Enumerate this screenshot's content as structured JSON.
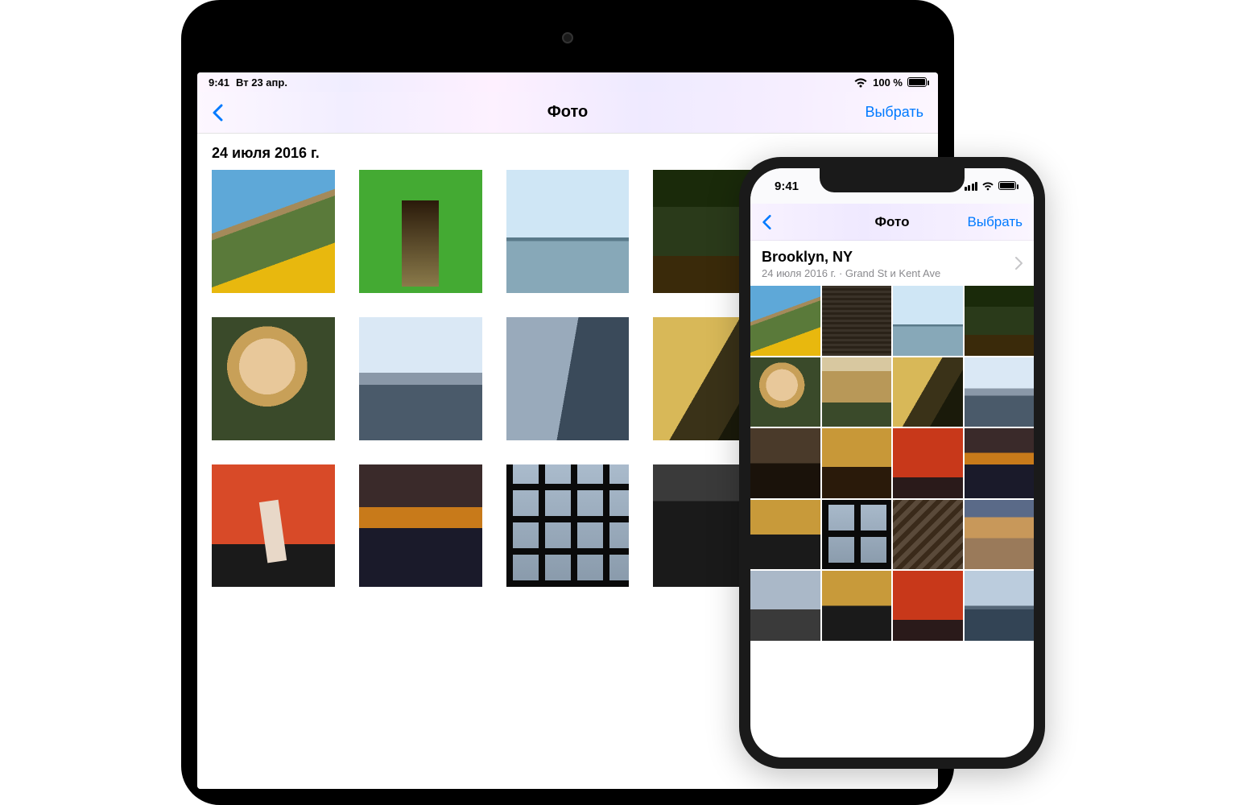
{
  "ipad": {
    "status": {
      "time": "9:41",
      "day": "Вт 23 апр.",
      "battery": "100 %"
    },
    "nav": {
      "title": "Фото",
      "select": "Выбрать"
    },
    "section_date": "24 июля 2016 г.",
    "thumbs": [
      "sunflower-bridge",
      "wall-shadow-person",
      "sunglasses-bridge",
      "trees-sky",
      "face-window-light",
      "curly-face-close",
      "skyline-empire",
      "person-lean-skyline",
      "curly-gold-jacket",
      "person-dark",
      "orange-wall-jump",
      "river-sunset",
      "window-grid-portrait",
      "figure-dark",
      "stairs"
    ]
  },
  "iphone": {
    "status": {
      "time": "9:41"
    },
    "nav": {
      "title": "Фото",
      "select": "Выбрать"
    },
    "location": {
      "title": "Brooklyn, NY",
      "subtitle": "24 июля 2016 г.  ·  Grand St и Kent Ave"
    },
    "thumbs": [
      "sunflower-bridge",
      "wall-shadow",
      "sunglasses-bridge",
      "trees-sky",
      "curly-face-close",
      "curly-face-2",
      "curly-gold-jacket",
      "skyline-empire",
      "person-dark",
      "gold-jacket-wall",
      "orange-wall",
      "river-sunset",
      "gold-pose",
      "window-grid",
      "stairs",
      "sunset-sky",
      "street",
      "gold-pose-2",
      "orange-2",
      "skyline-2"
    ]
  },
  "thumb_classes": {
    "sunflower-bridge": "ph-sunflower",
    "wall-shadow-person": "ph-wall-person",
    "wall-shadow": "ph-wall",
    "sunglasses-bridge": "ph-sky-bridge",
    "trees-sky": "ph-trees",
    "face-window-light": "ph-face-window",
    "curly-face-close": "ph-face-close",
    "curly-face-2": "ph-curly",
    "curly-gold-jacket": "ph-curly-gold",
    "skyline-empire": "ph-skyline",
    "skyline-2": "ph-skyline2",
    "person-lean-skyline": "ph-lean",
    "person-dark": "ph-dark",
    "gold-jacket-wall": "ph-gold-wall",
    "orange-wall-jump": "ph-orange-jump",
    "orange-wall": "ph-orange-wall",
    "orange-2": "ph-orange-wall",
    "river-sunset": "ph-sunset",
    "window-grid-portrait": "ph-window",
    "window-grid": "ph-window",
    "figure-dark": "ph-figure-dark",
    "stairs": "ph-stairs",
    "sunset-sky": "ph-sunset-sky",
    "street": "ph-street",
    "gold-pose": "ph-gold-pose",
    "gold-pose-2": "ph-gold-pose"
  }
}
